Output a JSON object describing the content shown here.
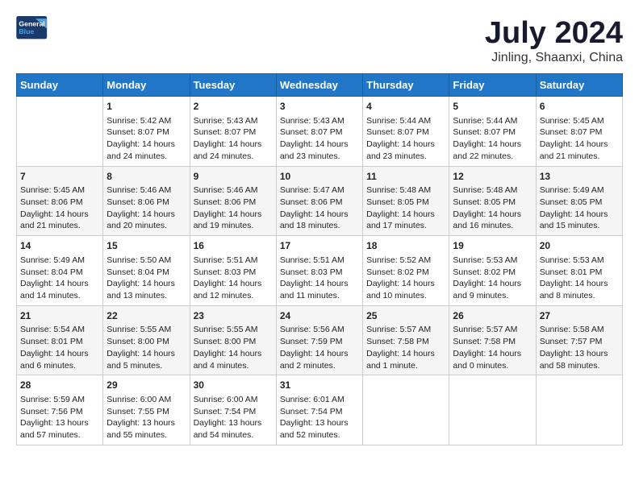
{
  "logo": {
    "text_general": "General",
    "text_blue": "Blue"
  },
  "title": "July 2024",
  "subtitle": "Jinling, Shaanxi, China",
  "headers": [
    "Sunday",
    "Monday",
    "Tuesday",
    "Wednesday",
    "Thursday",
    "Friday",
    "Saturday"
  ],
  "weeks": [
    [
      {
        "day": "",
        "info": ""
      },
      {
        "day": "1",
        "info": "Sunrise: 5:42 AM\nSunset: 8:07 PM\nDaylight: 14 hours\nand 24 minutes."
      },
      {
        "day": "2",
        "info": "Sunrise: 5:43 AM\nSunset: 8:07 PM\nDaylight: 14 hours\nand 24 minutes."
      },
      {
        "day": "3",
        "info": "Sunrise: 5:43 AM\nSunset: 8:07 PM\nDaylight: 14 hours\nand 23 minutes."
      },
      {
        "day": "4",
        "info": "Sunrise: 5:44 AM\nSunset: 8:07 PM\nDaylight: 14 hours\nand 23 minutes."
      },
      {
        "day": "5",
        "info": "Sunrise: 5:44 AM\nSunset: 8:07 PM\nDaylight: 14 hours\nand 22 minutes."
      },
      {
        "day": "6",
        "info": "Sunrise: 5:45 AM\nSunset: 8:07 PM\nDaylight: 14 hours\nand 21 minutes."
      }
    ],
    [
      {
        "day": "7",
        "info": "Sunrise: 5:45 AM\nSunset: 8:06 PM\nDaylight: 14 hours\nand 21 minutes."
      },
      {
        "day": "8",
        "info": "Sunrise: 5:46 AM\nSunset: 8:06 PM\nDaylight: 14 hours\nand 20 minutes."
      },
      {
        "day": "9",
        "info": "Sunrise: 5:46 AM\nSunset: 8:06 PM\nDaylight: 14 hours\nand 19 minutes."
      },
      {
        "day": "10",
        "info": "Sunrise: 5:47 AM\nSunset: 8:06 PM\nDaylight: 14 hours\nand 18 minutes."
      },
      {
        "day": "11",
        "info": "Sunrise: 5:48 AM\nSunset: 8:05 PM\nDaylight: 14 hours\nand 17 minutes."
      },
      {
        "day": "12",
        "info": "Sunrise: 5:48 AM\nSunset: 8:05 PM\nDaylight: 14 hours\nand 16 minutes."
      },
      {
        "day": "13",
        "info": "Sunrise: 5:49 AM\nSunset: 8:05 PM\nDaylight: 14 hours\nand 15 minutes."
      }
    ],
    [
      {
        "day": "14",
        "info": "Sunrise: 5:49 AM\nSunset: 8:04 PM\nDaylight: 14 hours\nand 14 minutes."
      },
      {
        "day": "15",
        "info": "Sunrise: 5:50 AM\nSunset: 8:04 PM\nDaylight: 14 hours\nand 13 minutes."
      },
      {
        "day": "16",
        "info": "Sunrise: 5:51 AM\nSunset: 8:03 PM\nDaylight: 14 hours\nand 12 minutes."
      },
      {
        "day": "17",
        "info": "Sunrise: 5:51 AM\nSunset: 8:03 PM\nDaylight: 14 hours\nand 11 minutes."
      },
      {
        "day": "18",
        "info": "Sunrise: 5:52 AM\nSunset: 8:02 PM\nDaylight: 14 hours\nand 10 minutes."
      },
      {
        "day": "19",
        "info": "Sunrise: 5:53 AM\nSunset: 8:02 PM\nDaylight: 14 hours\nand 9 minutes."
      },
      {
        "day": "20",
        "info": "Sunrise: 5:53 AM\nSunset: 8:01 PM\nDaylight: 14 hours\nand 8 minutes."
      }
    ],
    [
      {
        "day": "21",
        "info": "Sunrise: 5:54 AM\nSunset: 8:01 PM\nDaylight: 14 hours\nand 6 minutes."
      },
      {
        "day": "22",
        "info": "Sunrise: 5:55 AM\nSunset: 8:00 PM\nDaylight: 14 hours\nand 5 minutes."
      },
      {
        "day": "23",
        "info": "Sunrise: 5:55 AM\nSunset: 8:00 PM\nDaylight: 14 hours\nand 4 minutes."
      },
      {
        "day": "24",
        "info": "Sunrise: 5:56 AM\nSunset: 7:59 PM\nDaylight: 14 hours\nand 2 minutes."
      },
      {
        "day": "25",
        "info": "Sunrise: 5:57 AM\nSunset: 7:58 PM\nDaylight: 14 hours\nand 1 minute."
      },
      {
        "day": "26",
        "info": "Sunrise: 5:57 AM\nSunset: 7:58 PM\nDaylight: 14 hours\nand 0 minutes."
      },
      {
        "day": "27",
        "info": "Sunrise: 5:58 AM\nSunset: 7:57 PM\nDaylight: 13 hours\nand 58 minutes."
      }
    ],
    [
      {
        "day": "28",
        "info": "Sunrise: 5:59 AM\nSunset: 7:56 PM\nDaylight: 13 hours\nand 57 minutes."
      },
      {
        "day": "29",
        "info": "Sunrise: 6:00 AM\nSunset: 7:55 PM\nDaylight: 13 hours\nand 55 minutes."
      },
      {
        "day": "30",
        "info": "Sunrise: 6:00 AM\nSunset: 7:54 PM\nDaylight: 13 hours\nand 54 minutes."
      },
      {
        "day": "31",
        "info": "Sunrise: 6:01 AM\nSunset: 7:54 PM\nDaylight: 13 hours\nand 52 minutes."
      },
      {
        "day": "",
        "info": ""
      },
      {
        "day": "",
        "info": ""
      },
      {
        "day": "",
        "info": ""
      }
    ]
  ]
}
